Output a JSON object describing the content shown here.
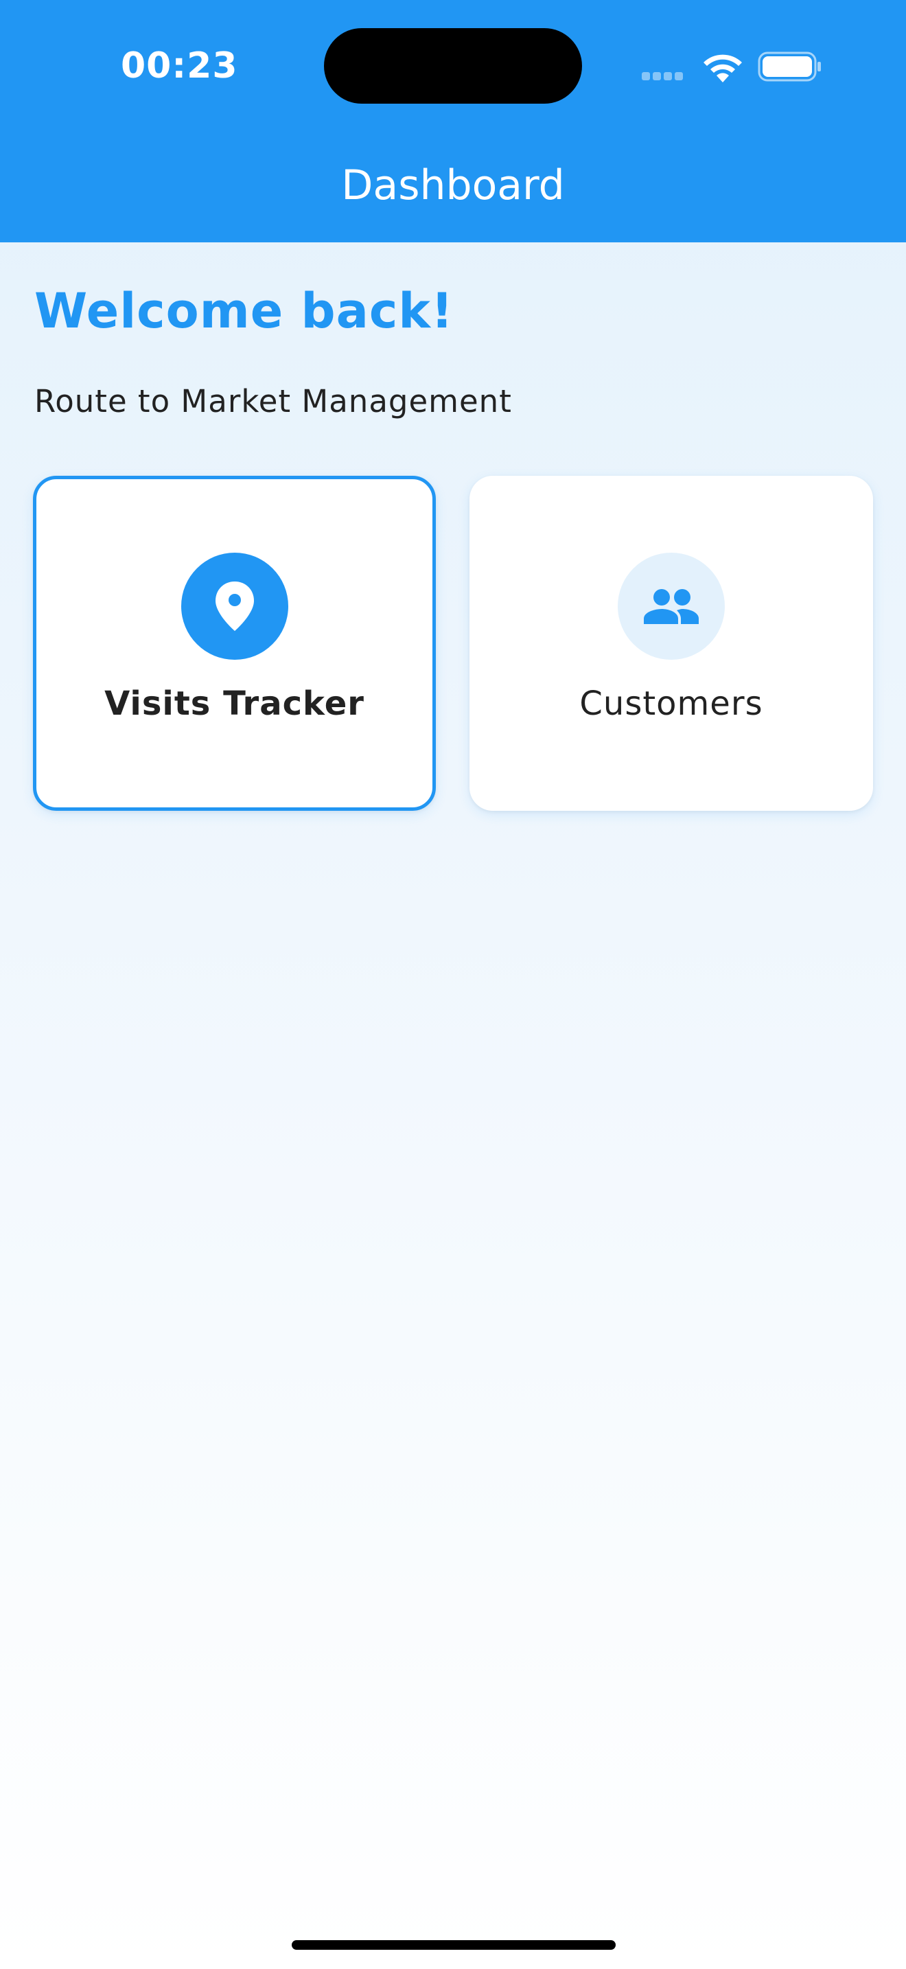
{
  "status_bar": {
    "time": "00:23",
    "wifi_icon": "wifi-icon",
    "battery_icon": "battery-icon"
  },
  "app_bar": {
    "title": "Dashboard",
    "background_color": "#2196f3"
  },
  "main": {
    "welcome": "Welcome back!",
    "subtitle": "Route to Market Management",
    "cards": [
      {
        "label": "Visits Tracker",
        "icon": "location-pin-icon",
        "selected": true
      },
      {
        "label": "Customers",
        "icon": "people-icon",
        "selected": false
      }
    ]
  },
  "colors": {
    "accent": "#2196f3",
    "accent_light": "#e3f1fc",
    "text": "#222222"
  }
}
